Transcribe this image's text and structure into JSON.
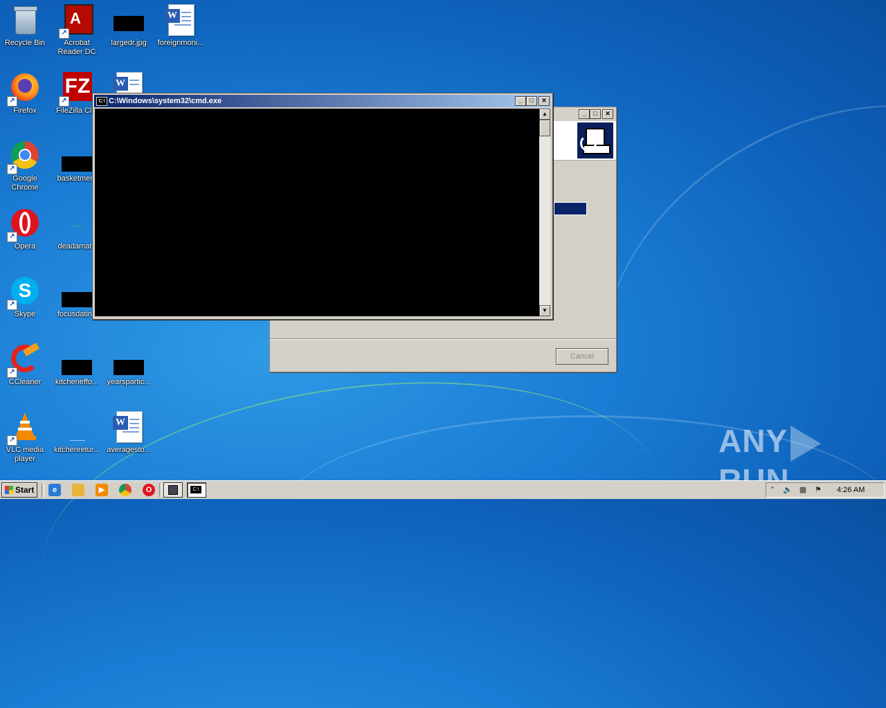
{
  "desktop": {
    "icons": [
      {
        "label": "Recycle Bin",
        "icon": "recycle-bin-icon"
      },
      {
        "label": "Acrobat Reader DC",
        "icon": "acrobat-icon"
      },
      {
        "label": "largedr.jpg",
        "icon": "image-file-icon"
      },
      {
        "label": "foreignmoni...",
        "icon": "word-doc-icon"
      },
      {
        "label": "Firefox",
        "icon": "firefox-icon"
      },
      {
        "label": "FileZilla Clie",
        "icon": "filezilla-icon"
      },
      {
        "label": "Google Chrome",
        "icon": "chrome-icon"
      },
      {
        "label": "basketmem",
        "icon": "image-file-icon"
      },
      {
        "label": "Opera",
        "icon": "opera-icon"
      },
      {
        "label": "deadamate",
        "icon": "image-file-icon"
      },
      {
        "label": "Skype",
        "icon": "skype-icon"
      },
      {
        "label": "focusdating",
        "icon": "image-file-icon"
      },
      {
        "label": "CCleaner",
        "icon": "ccleaner-icon"
      },
      {
        "label": "kitcheneffo...",
        "icon": "image-file-icon"
      },
      {
        "label": "yearspartic...",
        "icon": "image-file-icon"
      },
      {
        "label": "VLC media player",
        "icon": "vlc-icon"
      },
      {
        "label": "kitchenretur...",
        "icon": "image-file-icon"
      },
      {
        "label": "averagesto...",
        "icon": "word-doc-icon"
      }
    ]
  },
  "cmd_window": {
    "title": "C:\\Windows\\system32\\cmd.exe",
    "icon_text": "C:\\",
    "minimize": "_",
    "maximize": "□",
    "close": "✕",
    "scroll_up": "▲",
    "scroll_down": "▼"
  },
  "setup_dialog": {
    "cancel_label": "Cancel",
    "minimize": "_",
    "maximize": "□",
    "close": "✕"
  },
  "taskbar": {
    "start_label": "Start",
    "clock": "4:26 AM",
    "tray_up": "⌃",
    "cmd_task_icon": "C:\\"
  },
  "watermark": {
    "left": "ANY",
    "right": "RUN"
  }
}
